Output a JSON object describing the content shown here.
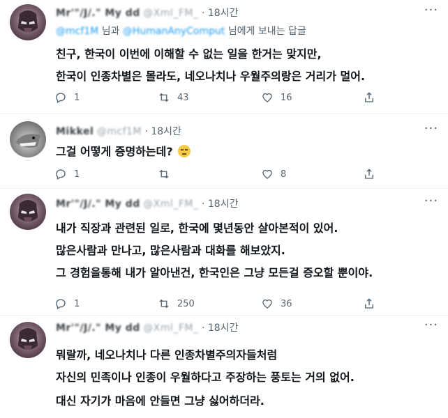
{
  "tweets": [
    {
      "avatar": "iron-helmet-avatar",
      "name": "Mr'\"/J/.\" My dd",
      "handle": "@Xml_FM_",
      "sep": "·",
      "time": "18시간",
      "reply_to": {
        "mention1": "@mcf1M",
        "joiner": "님과",
        "mention2": "@HumanAnyComput",
        "suffix": "님에게 보내는 답글"
      },
      "lines": [
        "친구, 한국이 이번에 이해할 수 없는 일을 한거는 맞지만,",
        "한국이 인종차별은 몰라도, 네오나치나 우월주의랑은 거리가 멀어."
      ],
      "stats": {
        "replies": "1",
        "retweets": "43",
        "likes": "16"
      }
    },
    {
      "avatar": "shark-avatar",
      "name": "Mikkel",
      "handle": "@mcf1M",
      "sep": "·",
      "time": "18시간",
      "lines": [
        "그걸 어떻게 증명하는데?"
      ],
      "emoji": "unamused-face-emoji",
      "stats": {
        "replies": "1",
        "retweets": "",
        "likes": "8"
      }
    },
    {
      "avatar": "iron-helmet-avatar",
      "name": "Mr'\"/J/.\" My dd",
      "handle": "@Xml_FM_",
      "sep": "·",
      "time": "18시간",
      "lines": [
        "내가 직장과 관련된 일로, 한국에 몇년동안 살아본적이 있어.",
        "많은사람과 만나고, 많은사람과 대화를 해보았지.",
        "그 경험을통해 내가 알아낸건, 한국인은 그냥 모든걸 증오할 뿐이야."
      ],
      "stats": {
        "replies": "1",
        "retweets": "250",
        "likes": "36"
      }
    },
    {
      "avatar": "iron-helmet-avatar",
      "name": "Mr'\"/J/.\" My dd",
      "handle": "@Xml_FM_",
      "sep": "·",
      "time": "18시간",
      "lines": [
        "뭐랄까, 네오나치나 다른 인종차별주의자들처럼",
        "자신의 민족이나 인종이 우월하다고 주장하는 풍토는 거의 없어.",
        "대신 자기가 마음에 안들면 그냥 싫어하더라."
      ]
    }
  ],
  "more_label": "···"
}
